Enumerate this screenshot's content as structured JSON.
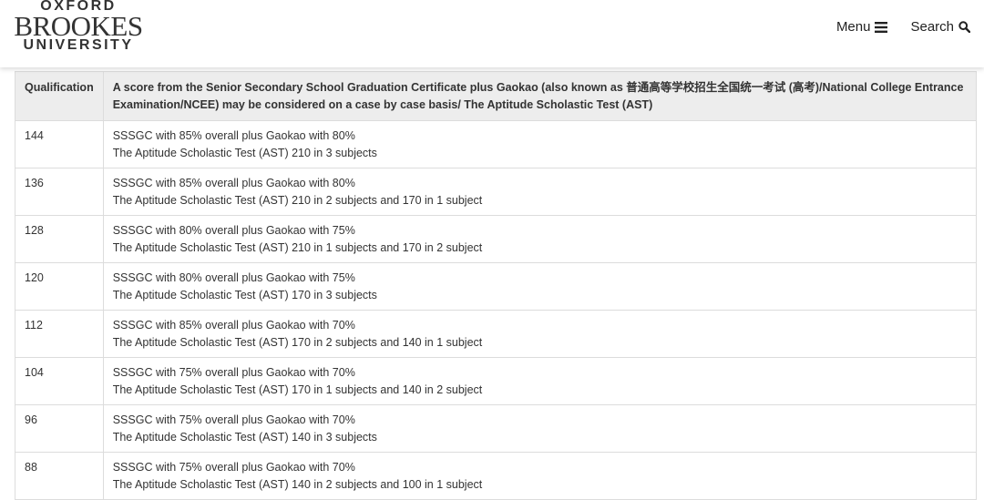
{
  "header": {
    "logo": {
      "line1": "OXFORD",
      "line2": "BROOKES",
      "line3": "UNIVERSITY"
    },
    "nav": {
      "menu_label": "Menu",
      "menu_icon": "hamburger-icon",
      "search_label": "Search",
      "search_icon": "search-icon"
    }
  },
  "table": {
    "headers": {
      "qualification": "Qualification",
      "requirement": "A score from the Senior Secondary School Graduation Certificate plus Gaokao (also known as 普通高等学校招生全国统一考试 (高考)/National College Entrance Examination/NCEE) may be considered on a case by case basis/ The Aptitude Scholastic Test (AST)"
    },
    "rows": [
      {
        "points": "144",
        "line1": "SSSGC with 85% overall plus Gaokao with 80%",
        "line2": "The Aptitude Scholastic Test (AST) 210 in 3 subjects"
      },
      {
        "points": "136",
        "line1": "SSSGC with 85% overall plus Gaokao with 80%",
        "line2": "The Aptitude Scholastic Test (AST) 210 in 2 subjects and 170 in 1 subject"
      },
      {
        "points": "128",
        "line1": "SSSGC with 80% overall plus Gaokao with 75%",
        "line2": "The Aptitude Scholastic Test (AST) 210 in 1 subjects and 170 in 2 subject"
      },
      {
        "points": "120",
        "line1": "SSSGC with 80% overall plus Gaokao with 75%",
        "line2": "The Aptitude Scholastic Test (AST) 170 in 3 subjects"
      },
      {
        "points": "112",
        "line1": "SSSGC with 85% overall plus Gaokao with 70%",
        "line2": "The Aptitude Scholastic Test (AST) 170 in 2 subjects and 140 in 1 subject"
      },
      {
        "points": "104",
        "line1": "SSSGC with 75% overall plus Gaokao with 70%",
        "line2": "The Aptitude Scholastic Test (AST) 170 in 1 subjects and 140 in 2 subject"
      },
      {
        "points": "96",
        "line1": "SSSGC with 75% overall plus Gaokao with 70%",
        "line2": "The Aptitude Scholastic Test (AST) 140 in 3 subjects"
      },
      {
        "points": "88",
        "line1": "SSSGC with 75% overall plus Gaokao with 70%",
        "line2": "The Aptitude Scholastic Test (AST) 140 in 2 subjects and 100 in 1 subject"
      }
    ]
  }
}
